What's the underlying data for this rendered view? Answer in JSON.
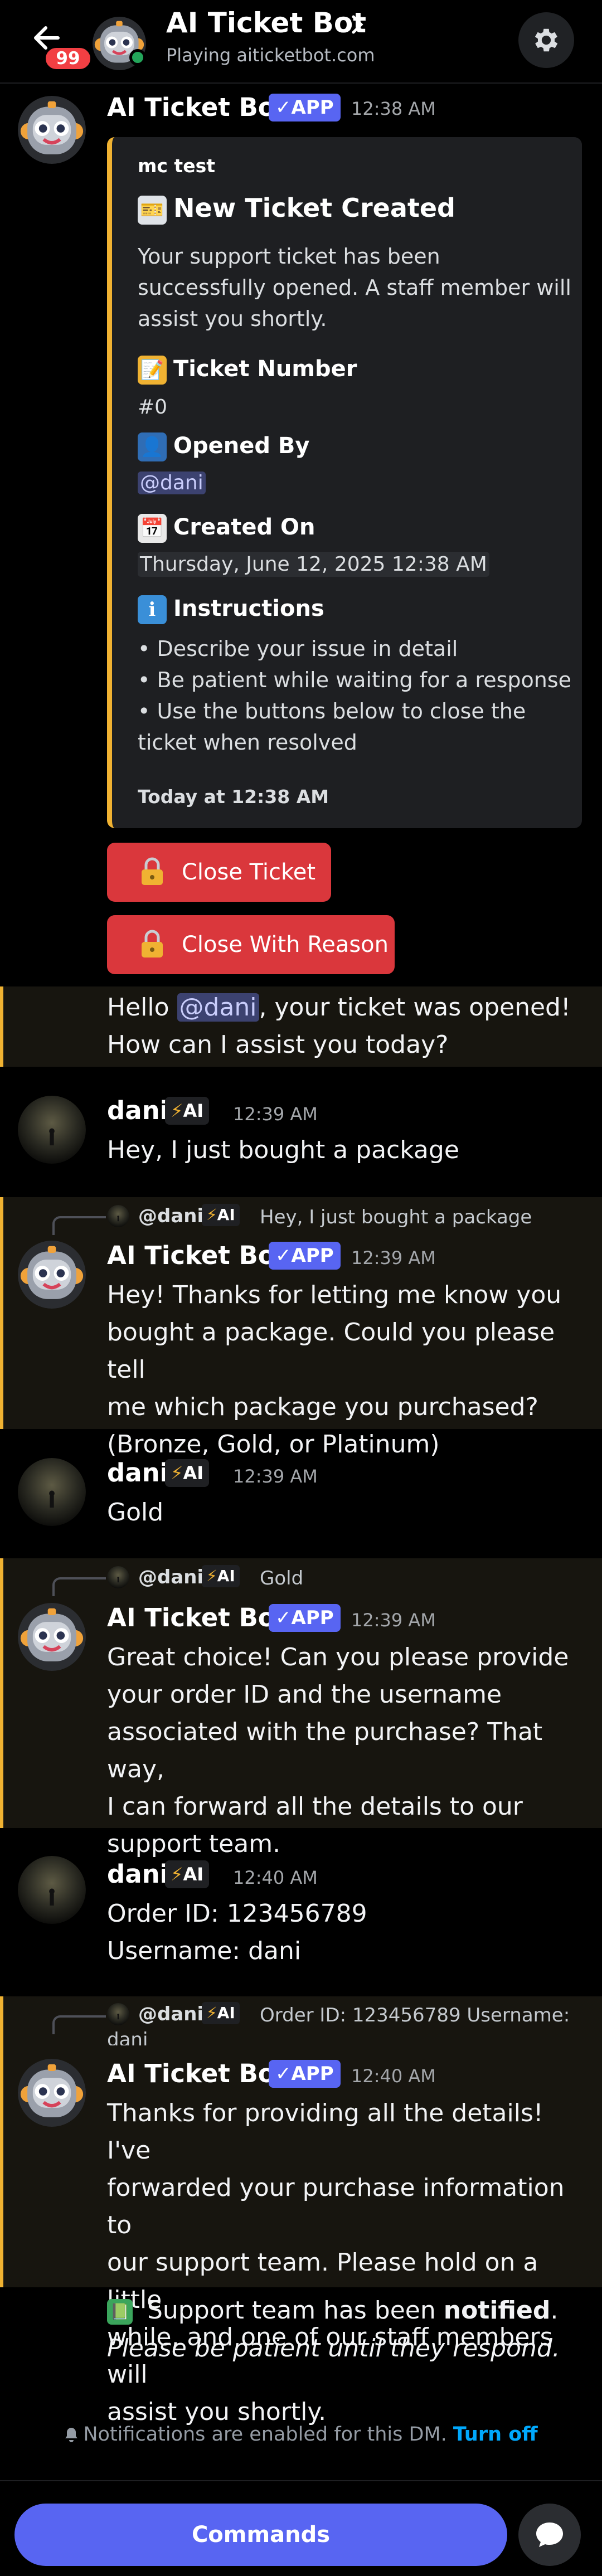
{
  "header": {
    "title": "AI Ticket Bot",
    "subtitle": "Playing aiticketbot.com",
    "unread_badge": "99"
  },
  "bot_name": "AI Ticket Bot",
  "user_name": "dani",
  "app_tag": "✓APP",
  "ai_tag": "AI",
  "ai_bolt": "⚡",
  "embed_message": {
    "timestamp": "12:38 AM",
    "author": "mc test",
    "title": "New Ticket Created",
    "title_emoji": "🎫",
    "description": "Your support ticket has been successfully opened. A staff member will assist you shortly.",
    "fields": [
      {
        "emoji": "📝",
        "name": "Ticket Number",
        "value": "#0"
      },
      {
        "emoji": "👤",
        "name": "Opened By",
        "value": "@dani"
      },
      {
        "emoji": "📅",
        "name": "Created On",
        "value": "Thursday, June 12, 2025 12:38 AM"
      },
      {
        "emoji": "ℹ",
        "name": "Instructions",
        "value": ""
      }
    ],
    "instructions": [
      "• Describe your issue in detail",
      "• Be patient while waiting for a response",
      "• Use the buttons below to close the",
      "ticket when resolved"
    ],
    "footer": "Today at 12:38 AM"
  },
  "buttons": {
    "close_ticket": "Close Ticket",
    "close_with_reason": "Close With Reason"
  },
  "greeting": {
    "part1": "Hello ",
    "mention": "@dani",
    "part2": ", your ticket was opened!",
    "line2": "How can I assist you today?"
  },
  "messages": [
    {
      "author": "dani",
      "time": "12:39 AM",
      "text": "Hey, I just bought a package"
    },
    {
      "author": "AI Ticket Bot",
      "time": "12:39 AM",
      "reply_to": "@dani",
      "reply_text": "Hey, I just bought a package",
      "text": "Hey! Thanks for letting me know you\nbought a package. Could you please tell\nme which package you purchased?\n(Bronze, Gold, or Platinum)"
    },
    {
      "author": "dani",
      "time": "12:39 AM",
      "text": "Gold"
    },
    {
      "author": "AI Ticket Bot",
      "time": "12:39 AM",
      "reply_to": "@dani",
      "reply_text": "Gold",
      "text": "Great choice! Can you please provide\nyour order ID and the username\nassociated with the purchase? That way,\nI can forward all the details to our\nsupport team."
    },
    {
      "author": "dani",
      "time": "12:40 AM",
      "text": "Order ID: 123456789\nUsername: dani"
    },
    {
      "author": "AI Ticket Bot",
      "time": "12:40 AM",
      "reply_to": "@dani",
      "reply_text": "Order ID: 123456789 Username:",
      "reply_text2": "dani",
      "text": "Thanks for providing all the details! I've\nforwarded your purchase information to\nour support team. Please hold on a little\nwhile, and one of our staff members will\nassist you shortly."
    }
  ],
  "system_note": {
    "emoji": "📗",
    "part1": " Support team has been ",
    "bold": "notified",
    "part2": ".",
    "line2": "Please be patient until they respond."
  },
  "notification": {
    "text": "Notifications are enabled for this DM.",
    "link": "Turn off"
  },
  "bottom": {
    "commands": "Commands"
  },
  "colors": {
    "accent": "#f0b232",
    "blurple": "#5865f2",
    "danger": "#da373c",
    "online": "#23a55a"
  }
}
